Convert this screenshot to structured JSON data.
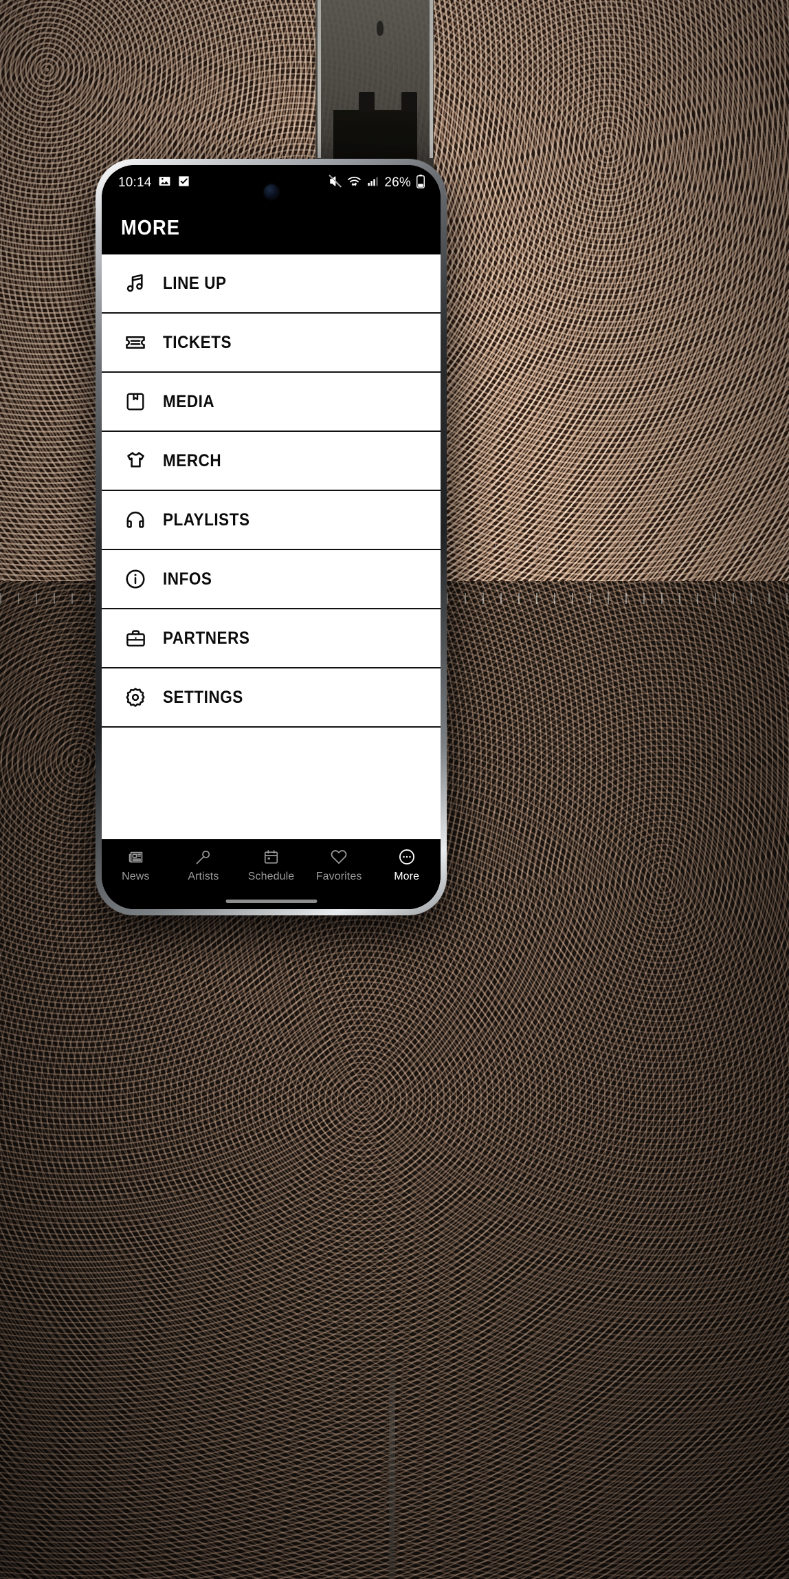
{
  "background": {
    "description": "aerial-festival-crowd-photo"
  },
  "status_bar": {
    "time": "10:14",
    "left_icons": [
      "image-icon",
      "checkbox-checked-icon"
    ],
    "right_icons": [
      "mute-icon",
      "wifi-icon",
      "signal-bars-icon"
    ],
    "battery_percent": "26%",
    "battery_icon": "battery-low-icon"
  },
  "app_header": {
    "title": "MORE"
  },
  "menu": {
    "items": [
      {
        "label": "LINE UP",
        "icon": "music-note-icon"
      },
      {
        "label": "TICKETS",
        "icon": "ticket-icon"
      },
      {
        "label": "MEDIA",
        "icon": "bookmark-box-icon"
      },
      {
        "label": "MERCH",
        "icon": "tshirt-icon"
      },
      {
        "label": "PLAYLISTS",
        "icon": "headphones-icon"
      },
      {
        "label": "INFOS",
        "icon": "info-circle-icon"
      },
      {
        "label": "PARTNERS",
        "icon": "briefcase-icon"
      },
      {
        "label": "SETTINGS",
        "icon": "gear-icon"
      }
    ]
  },
  "tabbar": {
    "items": [
      {
        "label": "News",
        "icon": "newspaper-icon",
        "active": false
      },
      {
        "label": "Artists",
        "icon": "microphone-icon",
        "active": false
      },
      {
        "label": "Schedule",
        "icon": "calendar-icon",
        "active": false
      },
      {
        "label": "Favorites",
        "icon": "heart-icon",
        "active": false
      },
      {
        "label": "More",
        "icon": "ellipsis-circle-icon",
        "active": true
      }
    ]
  },
  "colors": {
    "surface": "#ffffff",
    "on_surface": "#0b0b0b",
    "chrome": "#000000",
    "tab_inactive": "#9b9b9b",
    "tab_active": "#ffffff"
  }
}
